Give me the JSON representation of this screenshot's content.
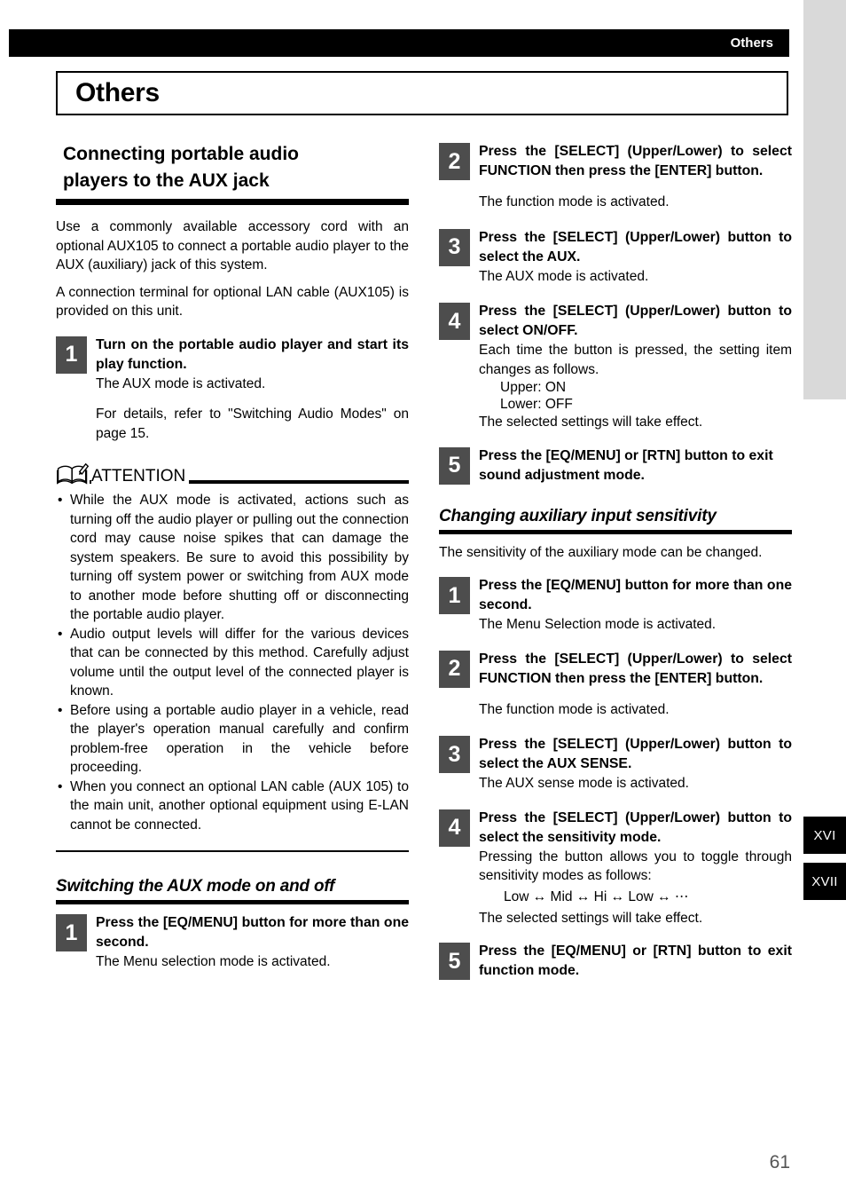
{
  "header": {
    "running_head": "Others",
    "chapter_title": "Others"
  },
  "page_number": "61",
  "edge_tabs": [
    {
      "label": "XVI"
    },
    {
      "label": "XVII"
    }
  ],
  "left_column": {
    "section_heading_line1": "Connecting portable audio",
    "section_heading_line2": "players to the AUX jack",
    "intro_paragraph_1": "Use a commonly available accessory cord with an optional AUX105 to connect a portable audio player to the AUX (auxiliary) jack of this system.",
    "intro_paragraph_2": "A connection terminal for optional LAN cable (AUX105) is provided on this unit.",
    "step1": {
      "number": "1",
      "title": "Turn on the portable audio player and start its play function.",
      "desc": "The AUX mode is activated.",
      "desc2": "For details, refer to \"Switching Audio Modes\" on page 15."
    },
    "attention": {
      "icon": "open-book-pencil-icon",
      "label": "ATTENTION",
      "bullets": [
        "While the AUX mode is activated, actions such as turning off the audio player or pulling out the connection cord may cause noise spikes that can damage the system speakers. Be sure to avoid this possibility by turning off system power or switching from AUX mode to another mode before shutting off or disconnecting the portable audio player.",
        "Audio output levels will differ for the various devices that can be connected by this method. Carefully adjust volume until the output level of the connected player is known.",
        "Before using a portable audio player in a vehicle, read the player's operation manual carefully and confirm problem-free operation in the vehicle before proceeding.",
        "When you connect an optional LAN cable (AUX 105) to the main unit, another optional equipment using E-LAN cannot be connected."
      ]
    },
    "sub_heading": "Switching the AUX mode on and off",
    "aux_step1": {
      "number": "1",
      "title": "Press the [EQ/MENU] button for more than one second.",
      "desc": "The Menu selection mode is activated."
    }
  },
  "right_column": {
    "aux_step2": {
      "number": "2",
      "title": "Press the [SELECT] (Upper/Lower) to select FUNCTION then press the [ENTER] button.",
      "desc": "The function mode is activated."
    },
    "aux_step3": {
      "number": "3",
      "title": "Press the [SELECT] (Upper/Lower) button to select the AUX.",
      "desc": "The AUX mode is activated."
    },
    "aux_step4": {
      "number": "4",
      "title": "Press the [SELECT] (Upper/Lower) button to select ON/OFF.",
      "desc": "Each time the button is pressed, the setting item changes as follows.",
      "sub_upper": "Upper: ON",
      "sub_lower": "Lower: OFF",
      "desc2": "The selected settings will take effect."
    },
    "aux_step5": {
      "number": "5",
      "title": "Press the [EQ/MENU] or [RTN] button to exit sound adjustment mode."
    },
    "sub_heading": "Changing auxiliary input sensitivity",
    "sens_intro": "The sensitivity of the auxiliary mode can be changed.",
    "sens_step1": {
      "number": "1",
      "title": "Press the [EQ/MENU] button for more than one second.",
      "desc": "The Menu Selection mode is activated."
    },
    "sens_step2": {
      "number": "2",
      "title": "Press the [SELECT] (Upper/Lower) to select FUNCTION then press the [ENTER] button.",
      "desc": "The function mode is activated."
    },
    "sens_step3": {
      "number": "3",
      "title": "Press the [SELECT] (Upper/Lower) button to select the AUX SENSE.",
      "desc": "The AUX sense mode is activated."
    },
    "sens_step4": {
      "number": "4",
      "title": "Press the [SELECT] (Upper/Lower) button to select the sensitivity mode.",
      "desc": "Pressing the button allows you to toggle through sensitivity modes as follows:",
      "sequence": "Low ↔ Mid ↔ Hi ↔ Low ↔ ⋯",
      "desc2": "The selected settings will take effect."
    },
    "sens_step5": {
      "number": "5",
      "title": "Press the [EQ/MENU] or [RTN] button to exit function mode."
    }
  },
  "colors": {
    "step_box": "#4d4d4d",
    "header_bar": "#000000",
    "edge_strip": "#d9d9d9",
    "page_number": "#555555"
  }
}
